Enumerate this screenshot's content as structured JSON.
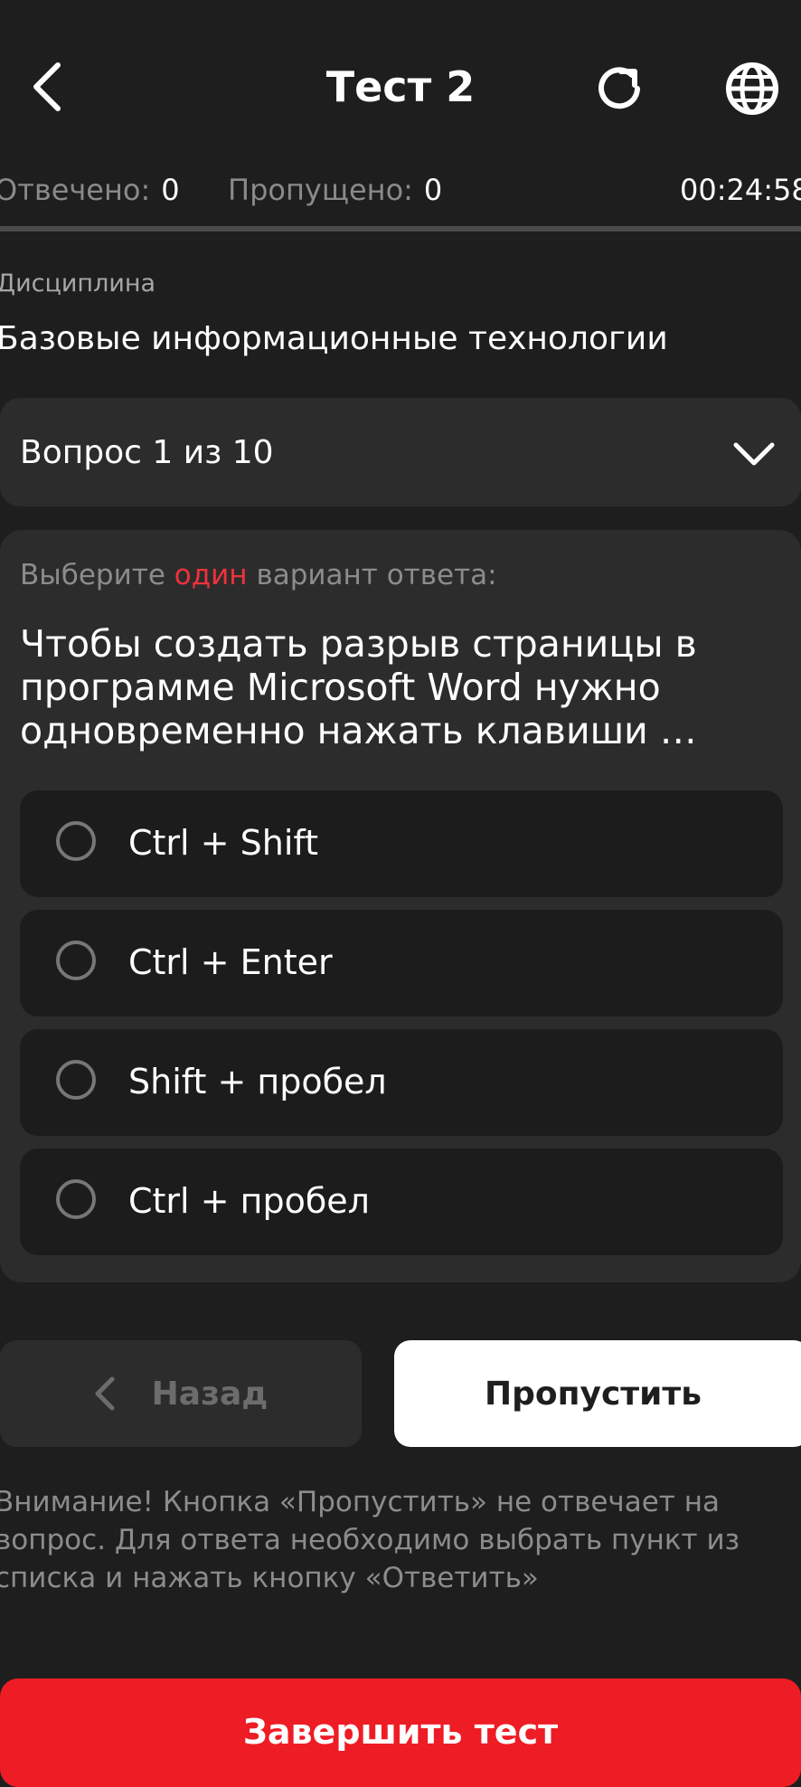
{
  "header": {
    "title": "Тест 2",
    "icons": {
      "back": "chevron-left-icon",
      "reload": "reload-icon",
      "language": "globe-icon"
    }
  },
  "stats": {
    "answered_label": "Отвечено:",
    "answered_value": "0",
    "skipped_label": "Пропущено:",
    "skipped_value": "0",
    "timer": "00:24:58"
  },
  "discipline": {
    "label": "Дисциплина",
    "name": "Базовые информационные технологии"
  },
  "question_selector": {
    "label": "Вопрос 1 из 10"
  },
  "question": {
    "instruction_prefix": "Выберите",
    "instruction_accent": "один",
    "instruction_suffix": "вариант ответа:",
    "text": "Чтобы создать разрыв страницы в программе Microsoft Word нужно одновременно нажать клавиши …",
    "options": [
      {
        "label": "Ctrl + Shift"
      },
      {
        "label": "Ctrl + Enter"
      },
      {
        "label": "Shift + пробел"
      },
      {
        "label": "Ctrl + пробел"
      }
    ]
  },
  "actions": {
    "back_label": "Назад",
    "skip_label": "Пропустить",
    "finish_label": "Завершить тест"
  },
  "warning": "Внимание! Кнопка «Пропустить» не отвечает на вопрос. Для ответа необходимо выбрать пункт из списка и нажать кнопку «Ответить»",
  "colors": {
    "background": "#1e1e1e",
    "card": "#2c2c2c",
    "option": "#1c1c1c",
    "accent": "#ee1c25",
    "muted": "#8c8c8c"
  }
}
